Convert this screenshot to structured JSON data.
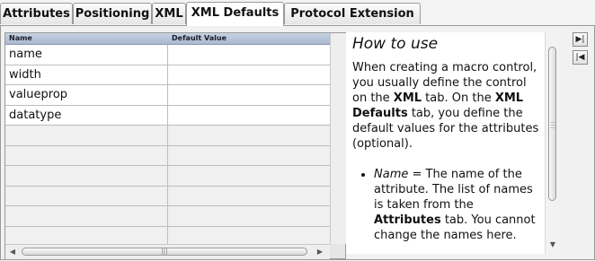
{
  "tabs": [
    {
      "label": "Attributes",
      "active": false
    },
    {
      "label": "Positioning",
      "active": false
    },
    {
      "label": "XML",
      "active": false
    },
    {
      "label": "XML Defaults",
      "active": true
    },
    {
      "label": "Protocol Extension",
      "active": false
    }
  ],
  "grid": {
    "columns": [
      "Name",
      "Default Value"
    ],
    "rows": [
      {
        "name": "name",
        "default_value": ""
      },
      {
        "name": "width",
        "default_value": ""
      },
      {
        "name": "valueprop",
        "default_value": ""
      },
      {
        "name": "datatype",
        "default_value": ""
      }
    ],
    "empty_row_count": 6
  },
  "help": {
    "title": "How to use",
    "paragraph": {
      "t1": "When creating a macro control, you usually define the control on the ",
      "b1": "XML",
      "t2": " tab. On the ",
      "b2": "XML Defaults",
      "t3": " tab, you define the default values for the attributes (optional)."
    },
    "bullet": {
      "i1": "Name",
      "t1": " = The name of the attribute. The list of names is taken from the ",
      "b1": "Attributes",
      "t2": " tab. You cannot change the names here."
    }
  },
  "side_buttons": [
    {
      "icon": "move-right-icon"
    },
    {
      "icon": "move-left-icon"
    }
  ],
  "colors": {
    "header_gradient_top": "#c6d2e2",
    "header_gradient_bottom": "#a9b9cf",
    "panel_bg": "#f1f1f1"
  }
}
